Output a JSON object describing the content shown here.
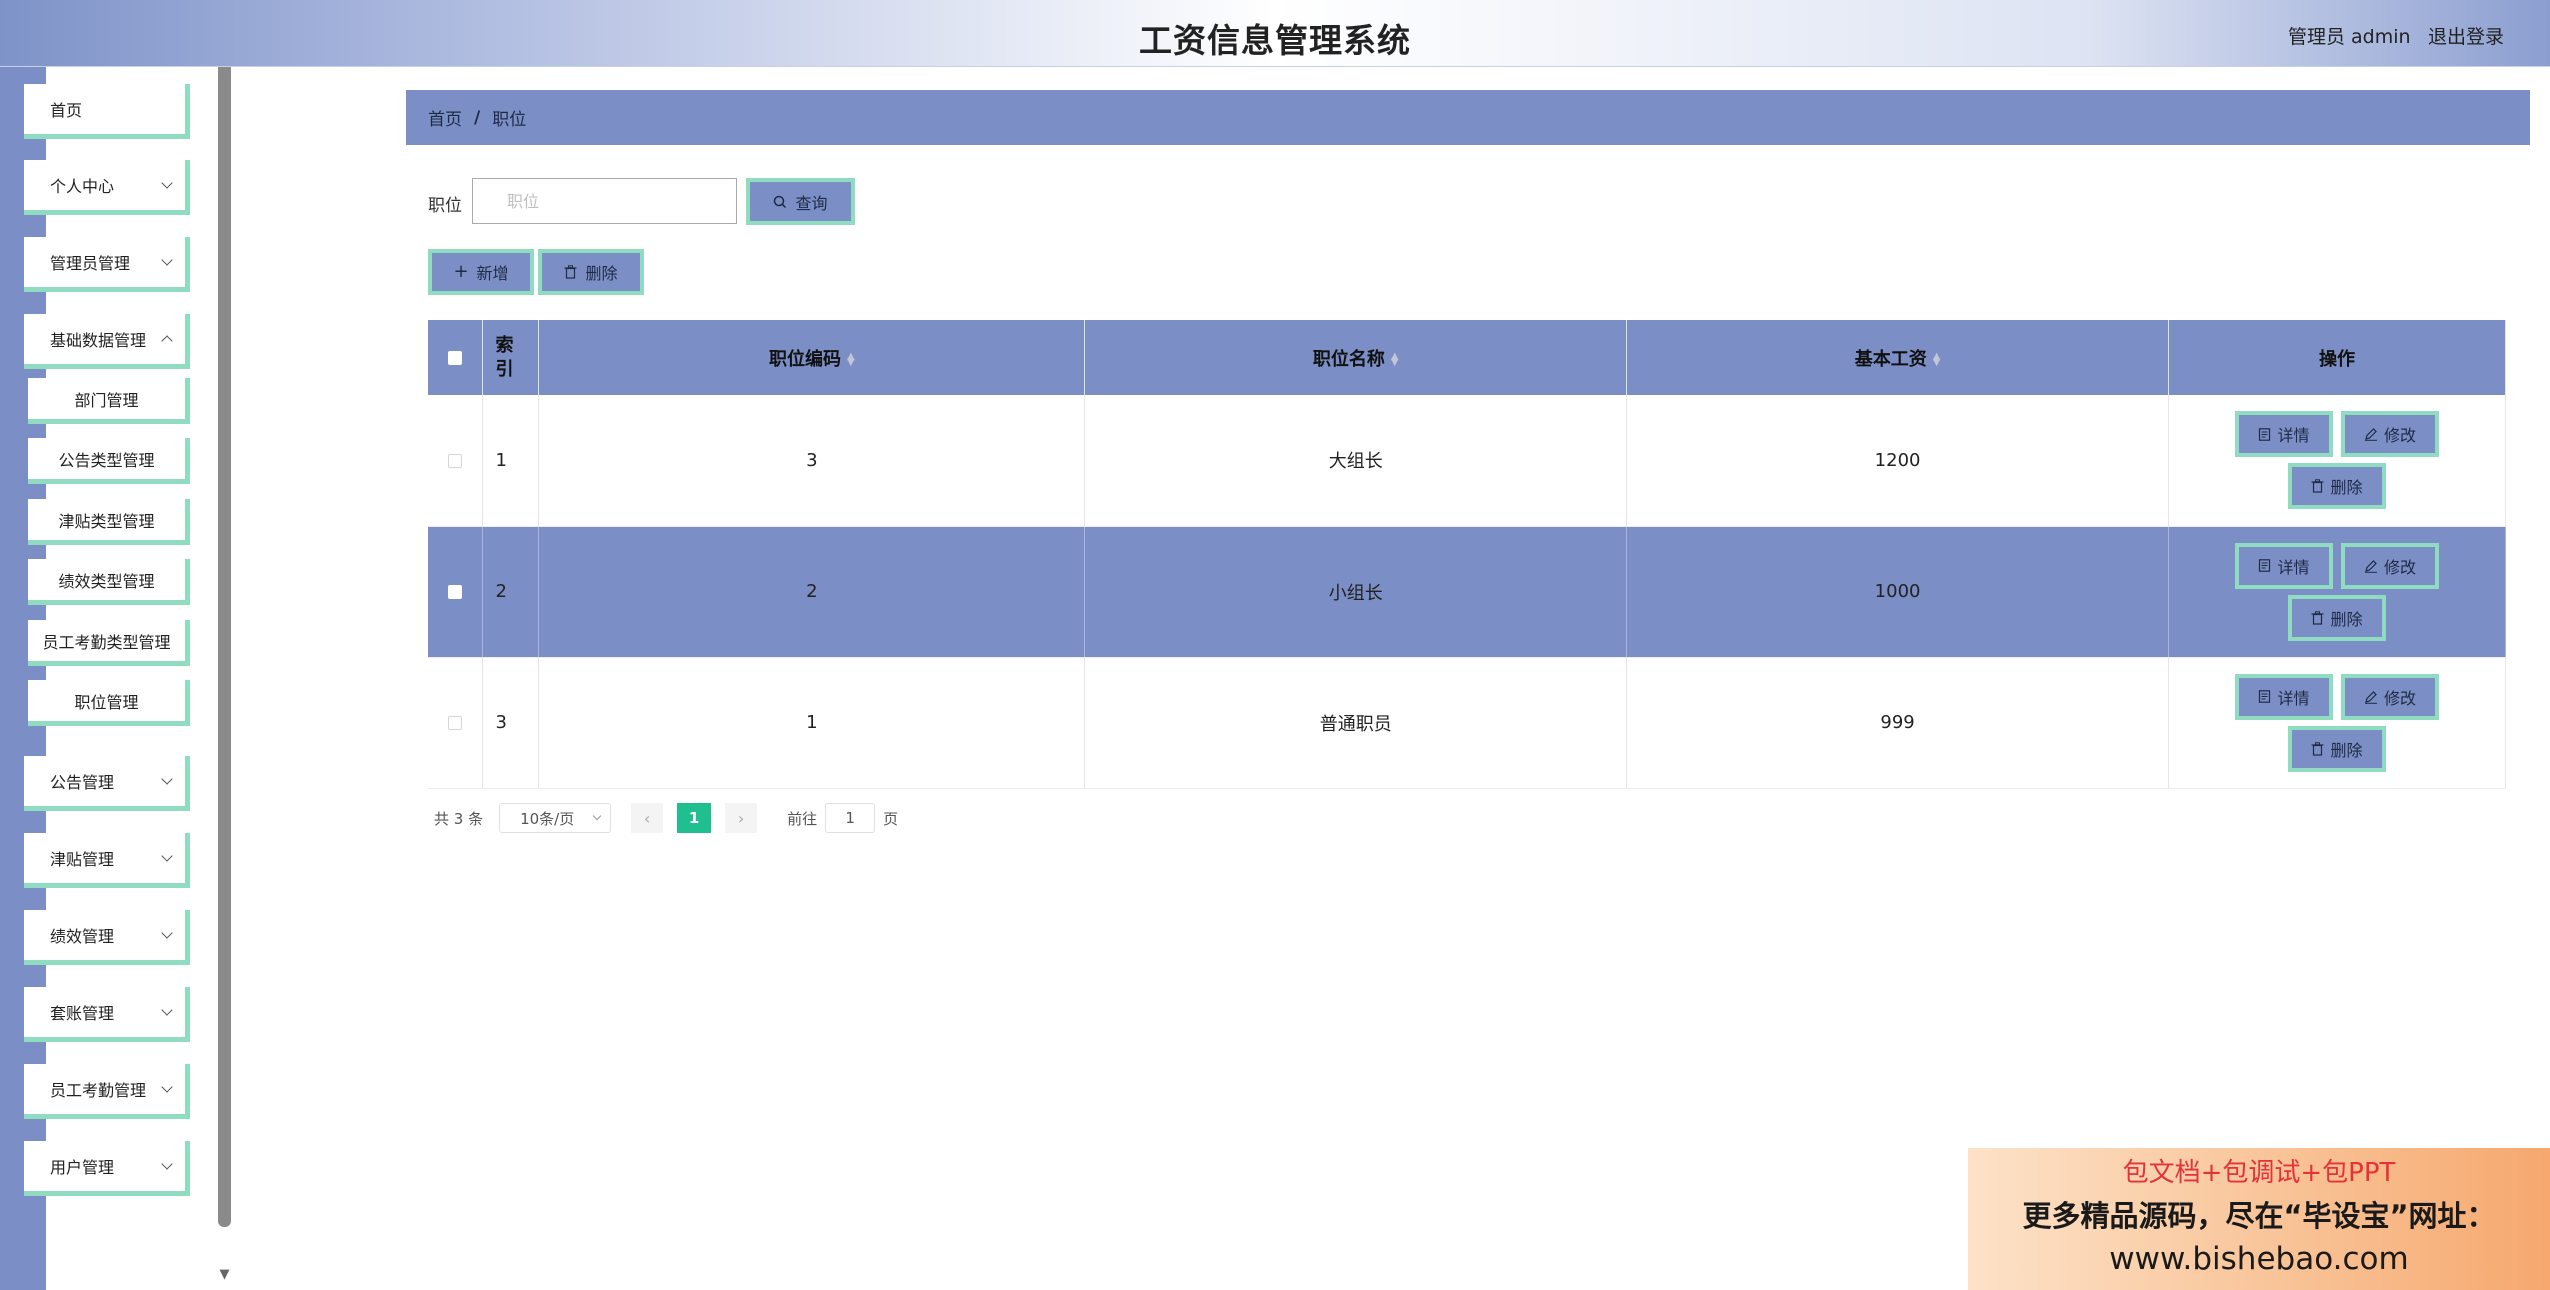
{
  "header": {
    "title": "工资信息管理系统",
    "user": "管理员 admin",
    "logout": "退出登录"
  },
  "sidebar": {
    "items": [
      {
        "label": "首页"
      },
      {
        "label": "个人中心"
      },
      {
        "label": "管理员管理"
      },
      {
        "label": "基础数据管理"
      },
      {
        "label": "部门管理"
      },
      {
        "label": "公告类型管理"
      },
      {
        "label": "津贴类型管理"
      },
      {
        "label": "绩效类型管理"
      },
      {
        "label": "员工考勤类型管理"
      },
      {
        "label": "职位管理"
      },
      {
        "label": "公告管理"
      },
      {
        "label": "津贴管理"
      },
      {
        "label": "绩效管理"
      },
      {
        "label": "套账管理"
      },
      {
        "label": "员工考勤管理"
      },
      {
        "label": "用户管理"
      }
    ]
  },
  "breadcrumb": {
    "home": "首页",
    "sep": "/",
    "current": "职位"
  },
  "search": {
    "label": "职位",
    "placeholder": "职位",
    "value": "",
    "button": "查询"
  },
  "toolbar": {
    "add": "新增",
    "delete": "删除"
  },
  "table": {
    "headers": {
      "index": "索引",
      "code": "职位编码",
      "name": "职位名称",
      "salary": "基本工资",
      "ops": "操作"
    },
    "rows": [
      {
        "index": "1",
        "code": "3",
        "name": "大组长",
        "salary": "1200",
        "selected": false
      },
      {
        "index": "2",
        "code": "2",
        "name": "小组长",
        "salary": "1000",
        "selected": true
      },
      {
        "index": "3",
        "code": "1",
        "name": "普通职员",
        "salary": "999",
        "selected": false
      }
    ],
    "ops": {
      "detail": "详情",
      "edit": "修改",
      "delete": "删除"
    }
  },
  "pagination": {
    "total": "共 3 条",
    "page_size": "10条/页",
    "current": "1",
    "goto_label": "前往",
    "goto_value": "1",
    "page_unit": "页"
  },
  "ad": {
    "line1": "包文档+包调试+包PPT",
    "line2": "更多精品源码，尽在“毕设宝”网址：",
    "line3": "www.bishebao.com"
  },
  "colors": {
    "accent": "#7b8fc6",
    "border_accent": "#8fdcc0",
    "page_active": "#1fbf8f"
  }
}
